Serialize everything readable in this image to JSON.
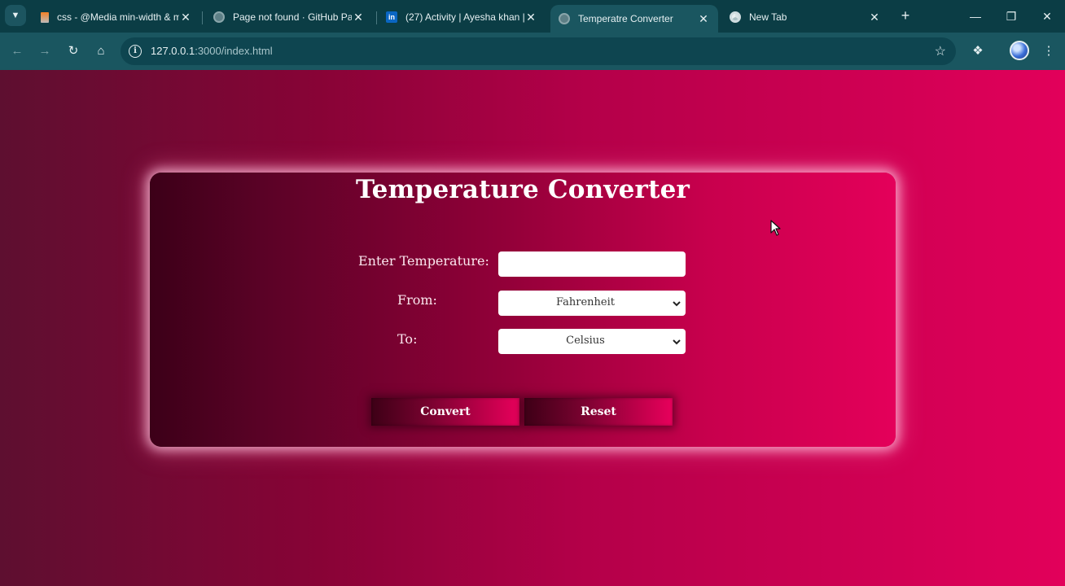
{
  "browser": {
    "tabs": [
      {
        "title": "css - @Media min-width & m",
        "favicon": "stackoverflow-icon"
      },
      {
        "title": "Page not found · GitHub Pa",
        "favicon": "globe-icon"
      },
      {
        "title": "(27) Activity | Ayesha khan |",
        "favicon": "linkedin-icon"
      },
      {
        "title": "Temperatre Converter",
        "favicon": "globe-icon",
        "active": true
      },
      {
        "title": "New Tab",
        "favicon": "chrome-icon"
      }
    ],
    "linkedin_glyph": "in",
    "address": {
      "host": "127.0.0.1",
      "path": ":3000/index.html"
    }
  },
  "page": {
    "title": "Temperature Converter",
    "labels": {
      "enter": "Enter Temperature:",
      "from": "From:",
      "to": "To:"
    },
    "input_value": "",
    "from_unit": "Fahrenheit",
    "to_unit": "Celsius",
    "buttons": {
      "convert": "Convert",
      "reset": "Reset"
    }
  },
  "colors": {
    "tab_strip": "#0b3d45",
    "toolbar": "#1a5660",
    "background_start": "#5e0f30",
    "background_end": "#e2005a",
    "card_glow": "#ffc8e1"
  }
}
